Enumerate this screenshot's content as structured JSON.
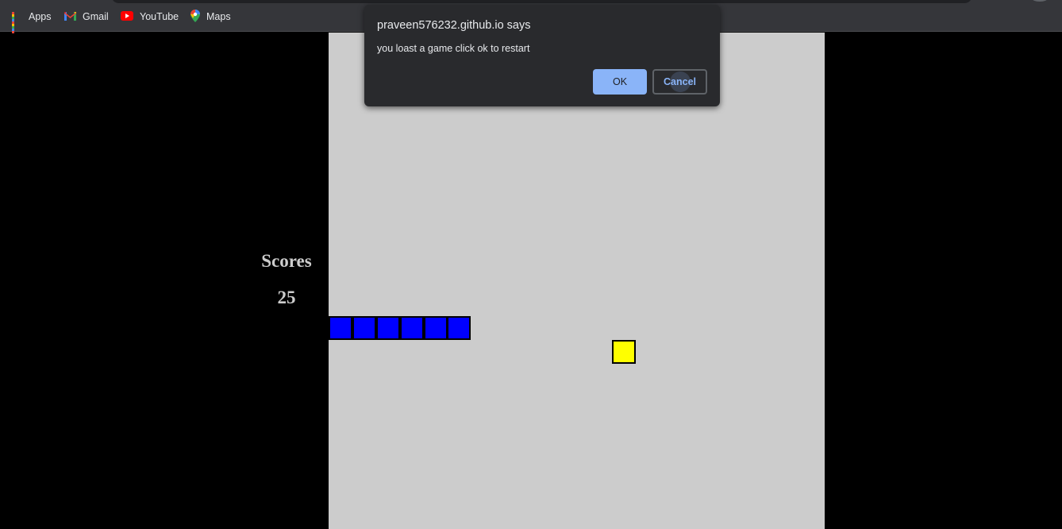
{
  "bookmarks": [
    {
      "label": "Apps",
      "icon": "apps-grid-icon"
    },
    {
      "label": "Gmail",
      "icon": "gmail-icon"
    },
    {
      "label": "YouTube",
      "icon": "youtube-icon"
    },
    {
      "label": "Maps",
      "icon": "maps-icon"
    }
  ],
  "dialog": {
    "title": "praveen576232.github.io says",
    "message": "you loast a game click ok to restart",
    "ok_label": "OK",
    "cancel_label": "Cancel"
  },
  "score": {
    "label": "Scores",
    "value": "25"
  },
  "game": {
    "board_color": "#cccccc",
    "snake_color": "#0000ff",
    "food_color": "#ffff00",
    "snake_length": 6,
    "direction": "left-to-right"
  },
  "colors": {
    "page_bg": "#000000",
    "accent": "#8ab4f8",
    "dialog_bg": "#292a2d"
  }
}
